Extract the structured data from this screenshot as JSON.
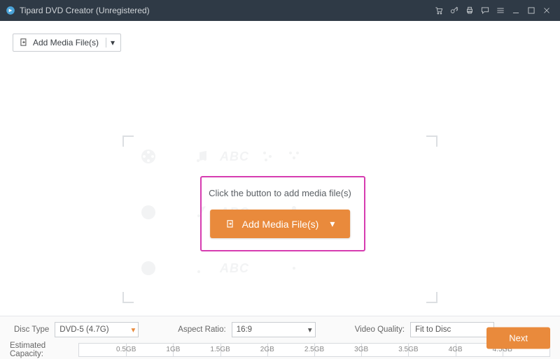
{
  "titlebar": {
    "title": "Tipard DVD Creator (Unregistered)"
  },
  "toolbar": {
    "add_media_label": "Add Media File(s)"
  },
  "center": {
    "prompt": "Click the button to add media file(s)",
    "button_label": "Add Media File(s)"
  },
  "bottom": {
    "disc_type_label": "Disc Type",
    "disc_type_value": "DVD-5 (4.7G)",
    "aspect_label": "Aspect Ratio:",
    "aspect_value": "16:9",
    "quality_label": "Video Quality:",
    "quality_value": "Fit to Disc",
    "capacity_label": "Estimated Capacity:",
    "scale_ticks": [
      "0.5GB",
      "1GB",
      "1.5GB",
      "2GB",
      "2.5GB",
      "3GB",
      "3.5GB",
      "4GB",
      "4.5GB"
    ],
    "next_label": "Next"
  },
  "watermark_text": "ABC"
}
